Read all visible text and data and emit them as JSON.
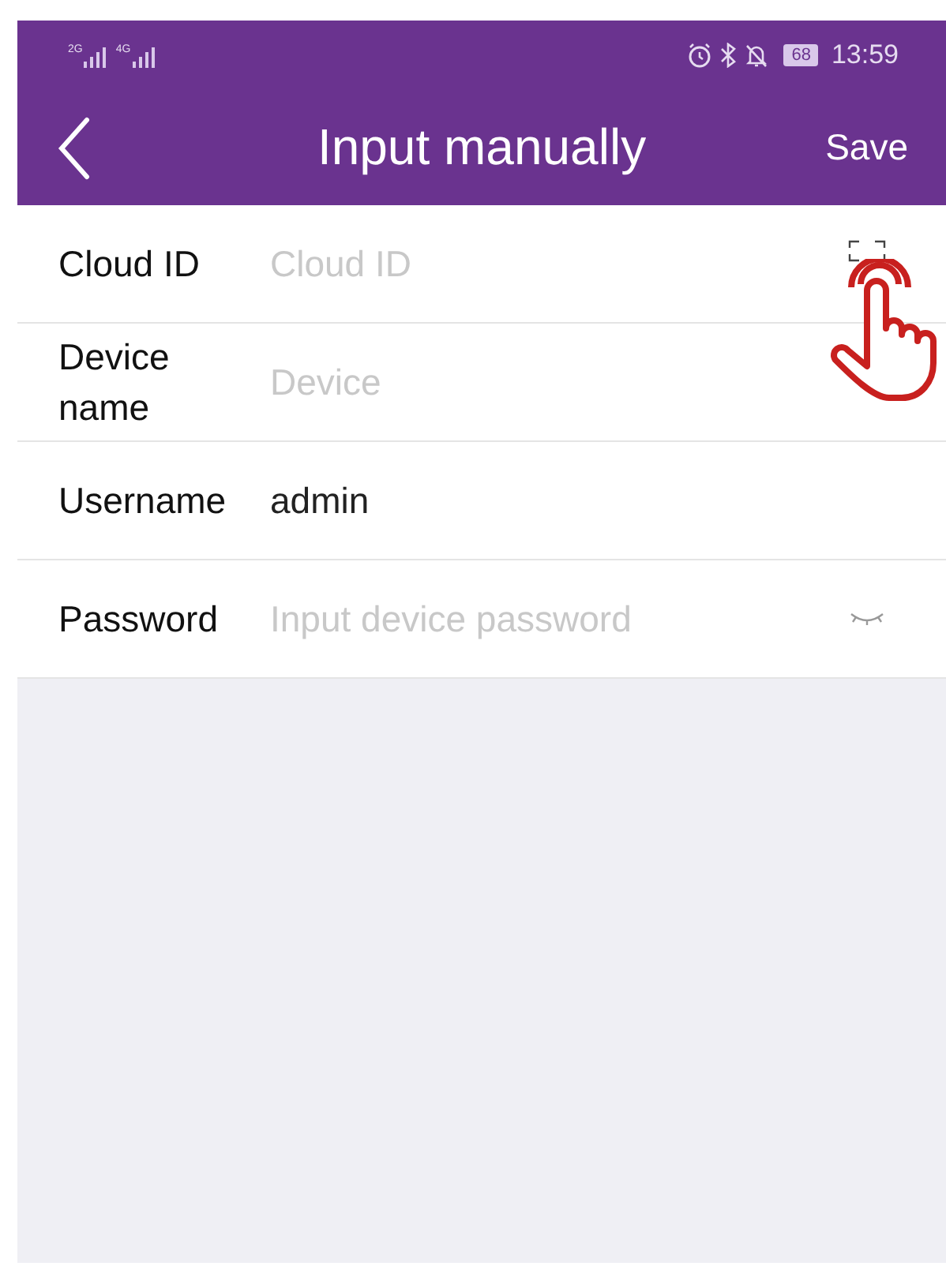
{
  "status_bar": {
    "signals": [
      "2G",
      "4G"
    ],
    "battery": "68",
    "time": "13:59"
  },
  "header": {
    "title": "Input manually",
    "action": "Save"
  },
  "fields": [
    {
      "label": "Cloud ID",
      "placeholder": "Cloud ID",
      "kind": "scan"
    },
    {
      "label": "Device name",
      "placeholder": "Device"
    },
    {
      "label": "Username",
      "value": "admin"
    },
    {
      "label": "Password",
      "placeholder": "Input device password",
      "kind": "password"
    }
  ]
}
